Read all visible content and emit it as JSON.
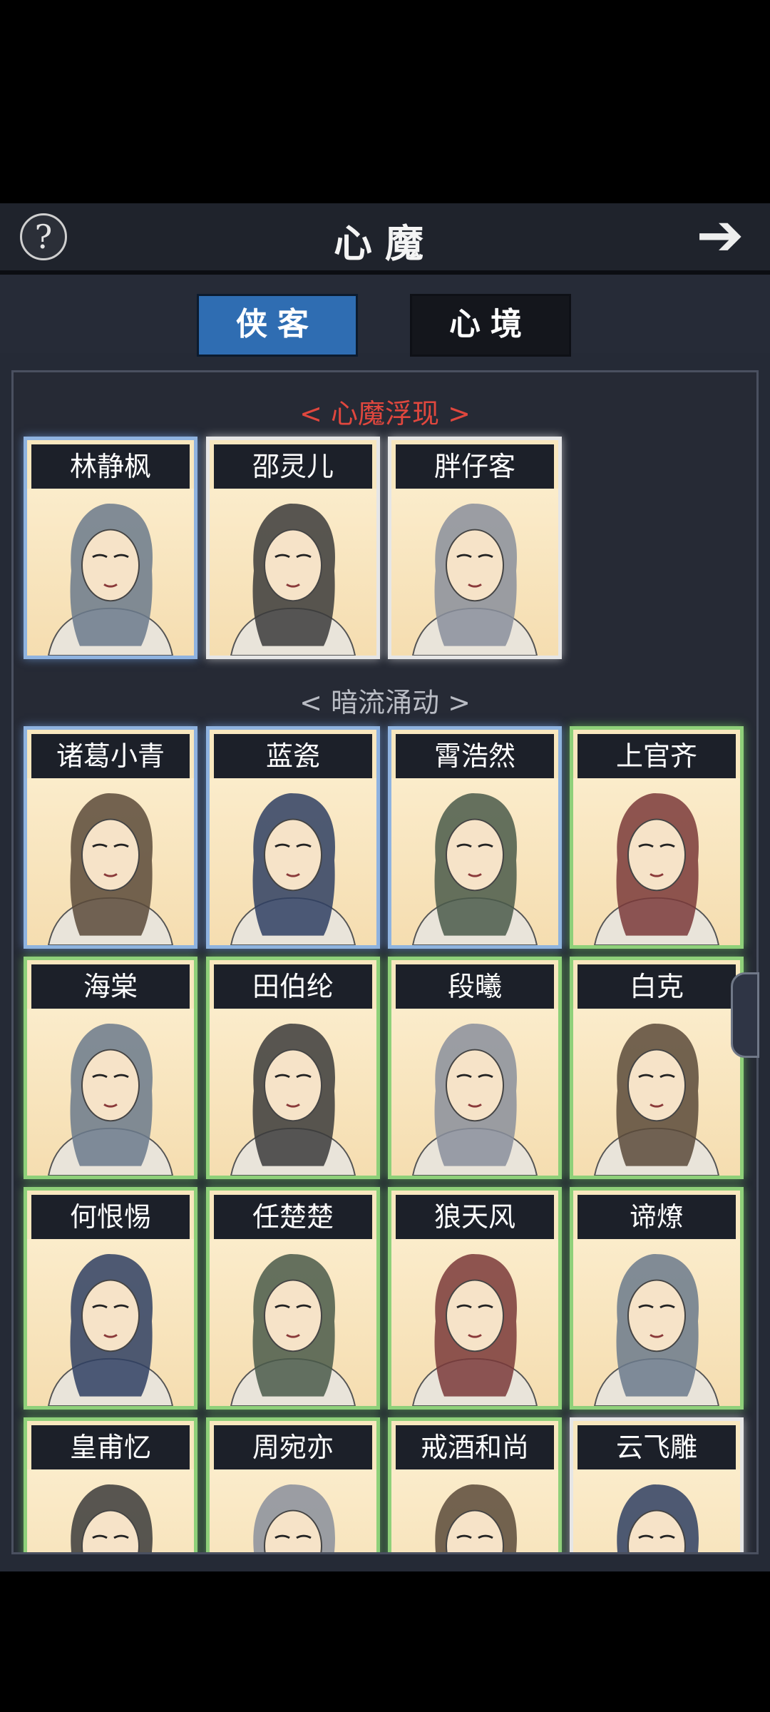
{
  "header": {
    "help_icon": "question-icon",
    "title": "心魔",
    "next_icon": "arrow-right-icon"
  },
  "tabs": {
    "active_label": "侠客",
    "idle_label": "心境"
  },
  "sections": {
    "first": "< 心魔浮现 >",
    "second": "< 暗流涌动 >"
  },
  "cards": [
    {
      "name": "林静枫",
      "frame": "blue"
    },
    {
      "name": "邵灵儿",
      "frame": "white"
    },
    {
      "name": "胖仔客",
      "frame": "white"
    },
    {
      "name": "诸葛小青",
      "frame": "blue"
    },
    {
      "name": "蓝瓷",
      "frame": "blue"
    },
    {
      "name": "霄浩然",
      "frame": "blue"
    },
    {
      "name": "上官齐",
      "frame": "green"
    },
    {
      "name": "海棠",
      "frame": "green"
    },
    {
      "name": "田伯纶",
      "frame": "green"
    },
    {
      "name": "段曦",
      "frame": "green"
    },
    {
      "name": "白克",
      "frame": "green"
    },
    {
      "name": "何恨惕",
      "frame": "green"
    },
    {
      "name": "任楚楚",
      "frame": "green"
    },
    {
      "name": "狼天风",
      "frame": "green"
    },
    {
      "name": "谛燎",
      "frame": "green"
    },
    {
      "name": "皇甫忆",
      "frame": "green"
    },
    {
      "name": "周宛亦",
      "frame": "green"
    },
    {
      "name": "戒酒和尚",
      "frame": "green"
    },
    {
      "name": "云飞雕",
      "frame": "white"
    }
  ]
}
